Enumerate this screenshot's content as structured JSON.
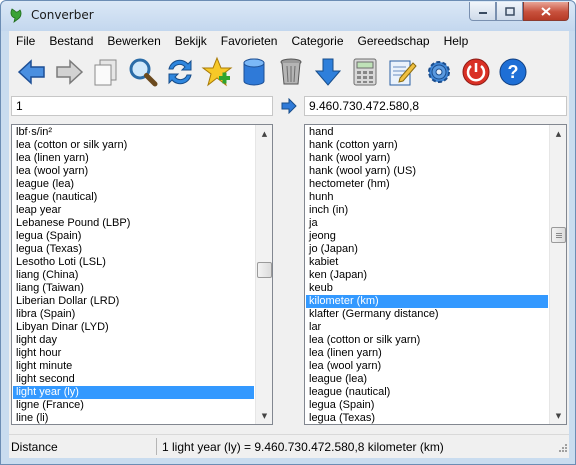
{
  "window": {
    "title": "Converber"
  },
  "menu": [
    "File",
    "Bestand",
    "Bewerken",
    "Bekijk",
    "Favorieten",
    "Categorie",
    "Gereedschap",
    "Help"
  ],
  "toolbar": {
    "buttons": [
      "back-arrow-icon",
      "forward-arrow-icon",
      "copy-icon",
      "magnifier-icon",
      "swap-icon",
      "favorite-star-icon",
      "database-icon",
      "trash-icon",
      "download-arrow-icon",
      "calculator-icon",
      "notepad-icon",
      "settings-gear-icon",
      "power-icon",
      "help-icon"
    ]
  },
  "input": {
    "from_value": "1",
    "to_value": "9.460.730.472.580,8"
  },
  "left_list": {
    "items": [
      "lbf·s/in²",
      "lea (cotton or silk yarn)",
      "lea (linen yarn)",
      "lea (wool yarn)",
      "league (lea)",
      "league (nautical)",
      "leap year",
      "Lebanese Pound (LBP)",
      "legua (Spain)",
      "legua (Texas)",
      "Lesotho Loti (LSL)",
      "liang (China)",
      "liang (Taiwan)",
      "Liberian Dollar (LRD)",
      "libra (Spain)",
      "Libyan Dinar (LYD)",
      "light day",
      "light hour",
      "light minute",
      "light second",
      "light year (ly)",
      "ligne (France)",
      "line (li)"
    ],
    "selected": "light year (ly)",
    "scroll_position": 0.48
  },
  "right_list": {
    "items": [
      "hand",
      "hank (cotton yarn)",
      "hank (wool yarn)",
      "hank (wool yarn) (US)",
      "hectometer (hm)",
      "hunh",
      "inch (in)",
      "ja",
      "jeong",
      "jo (Japan)",
      "kabiet",
      "ken (Japan)",
      "keub",
      "kilometer (km)",
      "klafter (Germany distance)",
      "lar",
      "lea (cotton or silk yarn)",
      "lea (linen yarn)",
      "lea (wool yarn)",
      "league (lea)",
      "league (nautical)",
      "legua (Spain)",
      "legua (Texas)"
    ],
    "selected": "kilometer (km)",
    "scroll_position": 0.34
  },
  "status": {
    "category": "Distance",
    "result": "1 light year (ly) = 9.460.730.472.580,8 kilometer (km)"
  },
  "colors": {
    "selection": "#3399ff",
    "accent_blue": "#1e6fd6"
  }
}
